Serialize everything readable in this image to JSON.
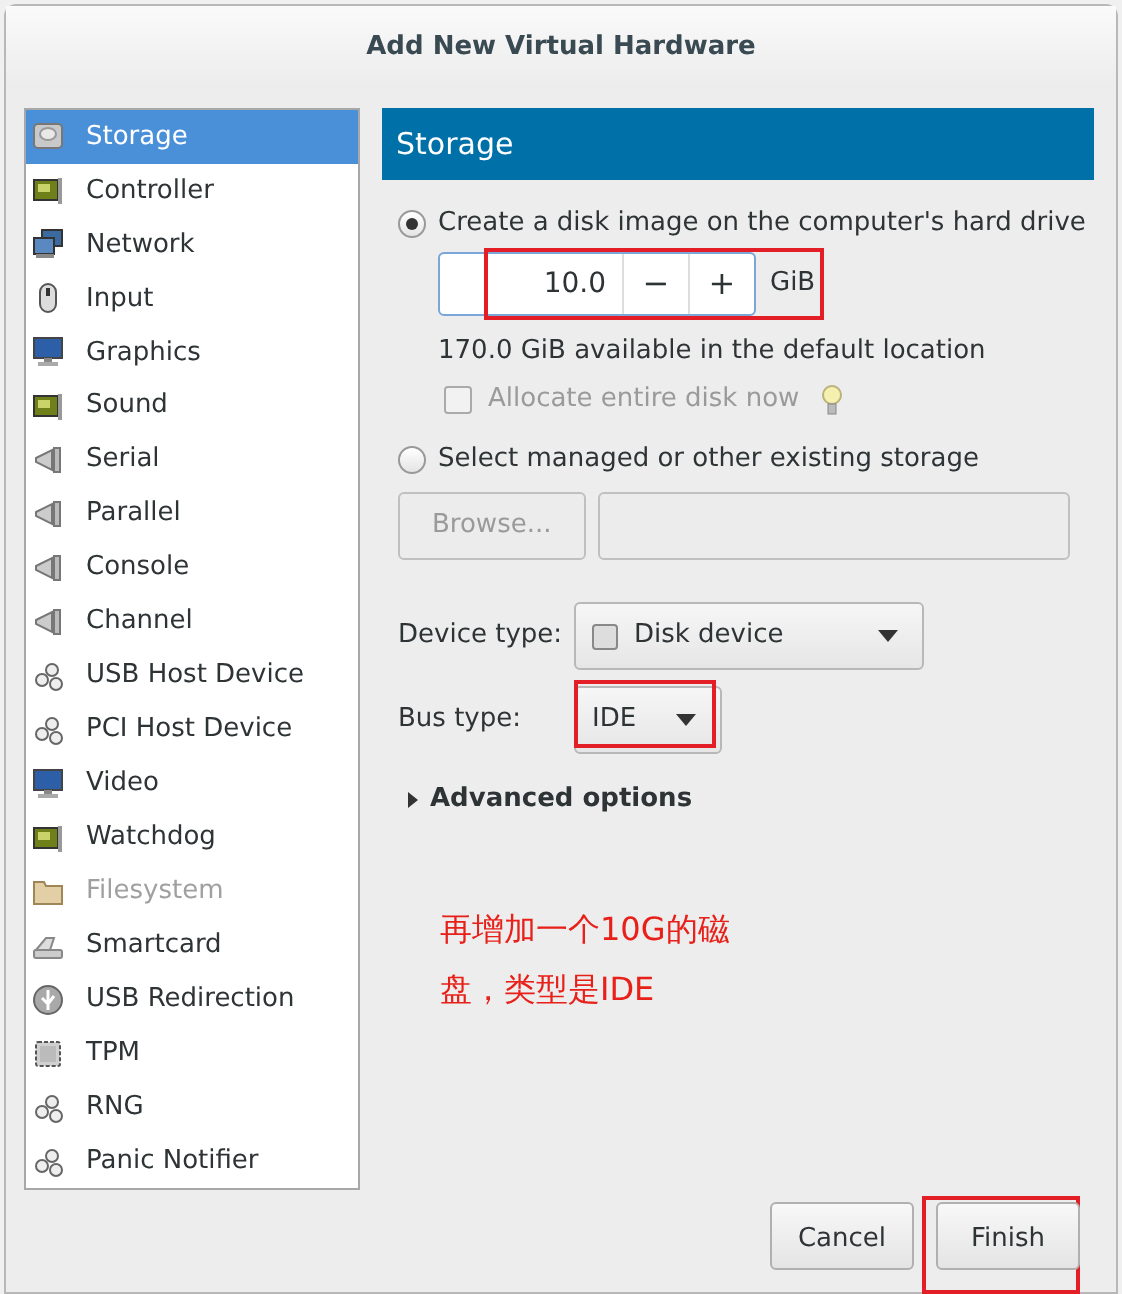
{
  "window": {
    "title": "Add New Virtual Hardware"
  },
  "sidebar": {
    "items": [
      {
        "label": "Storage",
        "kind": "disk",
        "selected": true,
        "disabled": false
      },
      {
        "label": "Controller",
        "kind": "card",
        "selected": false,
        "disabled": false
      },
      {
        "label": "Network",
        "kind": "network",
        "selected": false,
        "disabled": false
      },
      {
        "label": "Input",
        "kind": "mouse",
        "selected": false,
        "disabled": false
      },
      {
        "label": "Graphics",
        "kind": "monitor",
        "selected": false,
        "disabled": false
      },
      {
        "label": "Sound",
        "kind": "card",
        "selected": false,
        "disabled": false
      },
      {
        "label": "Serial",
        "kind": "plug",
        "selected": false,
        "disabled": false
      },
      {
        "label": "Parallel",
        "kind": "plug",
        "selected": false,
        "disabled": false
      },
      {
        "label": "Console",
        "kind": "plug",
        "selected": false,
        "disabled": false
      },
      {
        "label": "Channel",
        "kind": "plug",
        "selected": false,
        "disabled": false
      },
      {
        "label": "USB Host Device",
        "kind": "gears",
        "selected": false,
        "disabled": false
      },
      {
        "label": "PCI Host Device",
        "kind": "gears",
        "selected": false,
        "disabled": false
      },
      {
        "label": "Video",
        "kind": "monitor",
        "selected": false,
        "disabled": false
      },
      {
        "label": "Watchdog",
        "kind": "card",
        "selected": false,
        "disabled": false
      },
      {
        "label": "Filesystem",
        "kind": "folder",
        "selected": false,
        "disabled": true
      },
      {
        "label": "Smartcard",
        "kind": "smartcard",
        "selected": false,
        "disabled": false
      },
      {
        "label": "USB Redirection",
        "kind": "usb",
        "selected": false,
        "disabled": false
      },
      {
        "label": "TPM",
        "kind": "chip",
        "selected": false,
        "disabled": false
      },
      {
        "label": "RNG",
        "kind": "gears",
        "selected": false,
        "disabled": false
      },
      {
        "label": "Panic Notifier",
        "kind": "gears",
        "selected": false,
        "disabled": false
      }
    ]
  },
  "panel": {
    "header": "Storage",
    "create_option": {
      "label": "Create a disk image on the computer's hard drive",
      "selected": true
    },
    "size": {
      "value": "10.0",
      "decrement": "−",
      "increment": "+",
      "unit": "GiB"
    },
    "available": "170.0 GiB available in the default location",
    "allocate": {
      "label": "Allocate entire disk now",
      "checked": false,
      "disabled": true
    },
    "existing_option": {
      "label": "Select managed or other existing storage",
      "selected": false
    },
    "browse_button": {
      "label": "Browse...",
      "disabled": true
    },
    "device_type": {
      "label": "Device type:",
      "value": "Disk device"
    },
    "bus_type": {
      "label": "Bus type:",
      "value": "IDE"
    },
    "advanced": {
      "label": "Advanced options",
      "expanded": false
    }
  },
  "annotation": {
    "lines": [
      "再增加一个10G的磁",
      "盘，类型是IDE"
    ]
  },
  "buttons": [
    {
      "label": "Cancel"
    },
    {
      "label": "Finish"
    }
  ]
}
